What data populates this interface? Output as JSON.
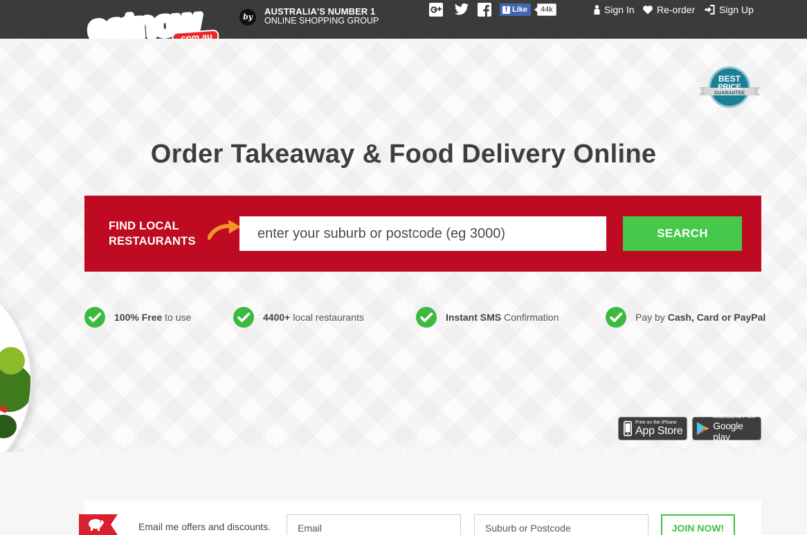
{
  "header": {
    "logo": {
      "main": "eatnow",
      "suffix": ".com.au",
      "icon": "eatnow-logo"
    },
    "by_label": "by",
    "group_tagline": {
      "line1": "AUSTRALIA'S NUMBER 1",
      "line2": "ONLINE SHOPPING GROUP"
    },
    "social": [
      {
        "icon": "google-plus-icon"
      },
      {
        "icon": "twitter-icon"
      },
      {
        "icon": "facebook-icon"
      }
    ],
    "like_button": {
      "label": "Like",
      "count": "44k"
    },
    "nav": {
      "signin": "Sign In",
      "reorder": "Re-order",
      "signup": "Sign Up"
    }
  },
  "badge": {
    "line1": "BEST",
    "line2": "PRICE",
    "line3": "GUARANTEE"
  },
  "hero": {
    "headline": {
      "bold1": "Order",
      "text1": " Takeaway & ",
      "bold2": "Food",
      "text2": " Delivery Online"
    },
    "search": {
      "label_line1": "FIND LOCAL",
      "label_line2": "RESTAURANTS",
      "placeholder": "enter your suburb or postcode (eg 3000)",
      "value": "",
      "button": "SEARCH"
    },
    "features": [
      {
        "bold": "100% Free",
        "text": " to use",
        "prefix": ""
      },
      {
        "bold": "4400+",
        "text": " local restaurants",
        "prefix": ""
      },
      {
        "bold": "Instant SMS",
        "text": " Confirmation",
        "prefix": ""
      },
      {
        "prefix": "Pay by ",
        "bold": "Cash, Card or PayPal",
        "text": ""
      }
    ],
    "app_badges": {
      "appstore": {
        "small": "Free on the iPhone",
        "big": "App Store"
      },
      "googleplay": {
        "small": "ANDROID APP ON",
        "big": "Google play"
      }
    }
  },
  "newsletter": {
    "label": "Email me offers and discounts.",
    "email_placeholder": "Email",
    "postcode_placeholder": "Suburb or Postcode",
    "join_button": "JOIN NOW!"
  },
  "colors": {
    "topbar": "#3b3b3b",
    "brand_red": "#be0b22",
    "logo_red": "#e8292c",
    "search_green": "#46c84a",
    "check_green": "#3cba3f",
    "arrow_orange": "#f39325",
    "badge_teal": "#1d7f94"
  }
}
